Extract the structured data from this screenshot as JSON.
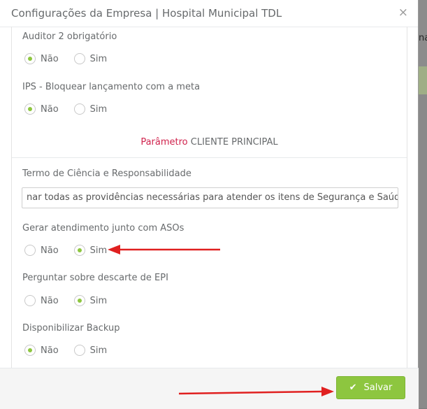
{
  "modal": {
    "title": "Configurações da Empresa | Hospital Municipal TDL",
    "close_label": "×"
  },
  "fields": [
    {
      "label": "Auditor 2 obrigatório",
      "options": [
        "Não",
        "Sim"
      ],
      "selected": "Não"
    },
    {
      "label": "IPS - Bloquear lançamento com a meta",
      "options": [
        "Não",
        "Sim"
      ],
      "selected": "Não"
    }
  ],
  "section": {
    "accent": "Parâmetro",
    "title": "CLIENTE PRINCIPAL"
  },
  "termo": {
    "label": "Termo de Ciência e Responsabilidade",
    "value": "nar todas as providências necessárias para atender os itens de Segurança e Saúde do Traba"
  },
  "client_fields": [
    {
      "label": "Gerar atendimento junto com ASOs",
      "options": [
        "Não",
        "Sim"
      ],
      "selected": "Sim"
    },
    {
      "label": "Perguntar sobre descarte de EPI",
      "options": [
        "Não",
        "Sim"
      ],
      "selected": "Sim"
    },
    {
      "label": "Disponibilizar Backup",
      "options": [
        "Não",
        "Sim"
      ],
      "selected": "Não"
    }
  ],
  "footer": {
    "save_label": "Salvar"
  },
  "background": {
    "partial_text": "na"
  },
  "colors": {
    "accent_green": "#8dc63f",
    "accent_red": "#d0234d",
    "arrow_red": "#e02020"
  }
}
